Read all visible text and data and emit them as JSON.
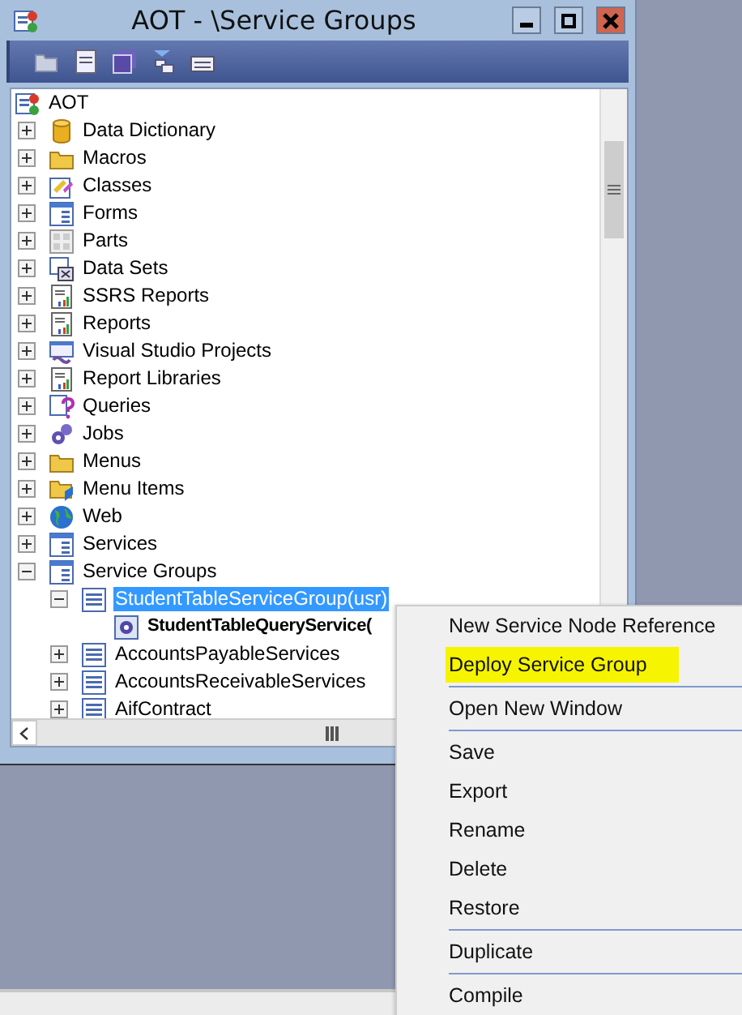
{
  "window": {
    "title": "AOT - \\Service Groups"
  },
  "toolbar": {
    "buttons": [
      {
        "kind": "open"
      },
      {
        "kind": "properties"
      },
      {
        "kind": "save"
      },
      {
        "kind": "filter"
      },
      {
        "kind": "compile"
      }
    ]
  },
  "tree": {
    "root": {
      "label": "AOT",
      "kind": "aot",
      "selected": false
    },
    "items": [
      {
        "label": "Data Dictionary",
        "kind": "database",
        "expanded": false,
        "selected": false
      },
      {
        "label": "Macros",
        "kind": "macros",
        "expanded": false,
        "selected": false
      },
      {
        "label": "Classes",
        "kind": "classes",
        "expanded": false,
        "selected": false
      },
      {
        "label": "Forms",
        "kind": "form",
        "expanded": false,
        "selected": false
      },
      {
        "label": "Parts",
        "kind": "parts",
        "expanded": false,
        "selected": false
      },
      {
        "label": "Data Sets",
        "kind": "dataset",
        "expanded": false,
        "selected": false
      },
      {
        "label": "SSRS Reports",
        "kind": "report",
        "expanded": false,
        "selected": false
      },
      {
        "label": "Reports",
        "kind": "report",
        "expanded": false,
        "selected": false
      },
      {
        "label": "Visual Studio Projects",
        "kind": "project",
        "expanded": false,
        "selected": false
      },
      {
        "label": "Report Libraries",
        "kind": "library",
        "expanded": false,
        "selected": false
      },
      {
        "label": "Queries",
        "kind": "query",
        "expanded": false,
        "selected": false
      },
      {
        "label": "Jobs",
        "kind": "job",
        "expanded": false,
        "selected": false
      },
      {
        "label": "Menus",
        "kind": "menu",
        "expanded": false,
        "selected": false
      },
      {
        "label": "Menu Items",
        "kind": "menuitem",
        "expanded": false,
        "selected": false
      },
      {
        "label": "Web",
        "kind": "web",
        "expanded": false,
        "selected": false
      },
      {
        "label": "Services",
        "kind": "service",
        "expanded": false,
        "selected": false
      },
      {
        "label": "Service Groups",
        "kind": "service",
        "expanded": true,
        "selected": false,
        "children": [
          {
            "label": "StudentTableServiceGroup(usr)",
            "kind": "group",
            "expanded": true,
            "selected": true,
            "children": [
              {
                "label": "StudentTableQueryService(",
                "kind": "node",
                "selected": false,
                "bold": true
              }
            ]
          },
          {
            "label": "AccountsPayableServices",
            "kind": "group",
            "expanded": false,
            "selected": false
          },
          {
            "label": "AccountsReceivableServices",
            "kind": "group",
            "expanded": false,
            "selected": false
          },
          {
            "label": "AifContract",
            "kind": "group",
            "expanded": false,
            "selected": false
          }
        ]
      }
    ]
  },
  "context_menu": {
    "items": [
      {
        "kind": "item",
        "label": "New Service Node Reference",
        "highlighted": false
      },
      {
        "kind": "item",
        "label": "Deploy Service Group",
        "highlighted": true
      },
      {
        "kind": "separator"
      },
      {
        "kind": "item",
        "label": "Open New Window",
        "highlighted": false
      },
      {
        "kind": "separator"
      },
      {
        "kind": "item",
        "label": "Save",
        "highlighted": false
      },
      {
        "kind": "item",
        "label": "Export",
        "highlighted": false
      },
      {
        "kind": "item",
        "label": "Rename",
        "highlighted": false
      },
      {
        "kind": "item",
        "label": "Delete",
        "highlighted": false
      },
      {
        "kind": "item",
        "label": "Restore",
        "highlighted": false
      },
      {
        "kind": "separator"
      },
      {
        "kind": "item",
        "label": "Duplicate",
        "highlighted": false
      },
      {
        "kind": "separator"
      },
      {
        "kind": "item",
        "label": "Compile",
        "highlighted": false
      }
    ]
  }
}
